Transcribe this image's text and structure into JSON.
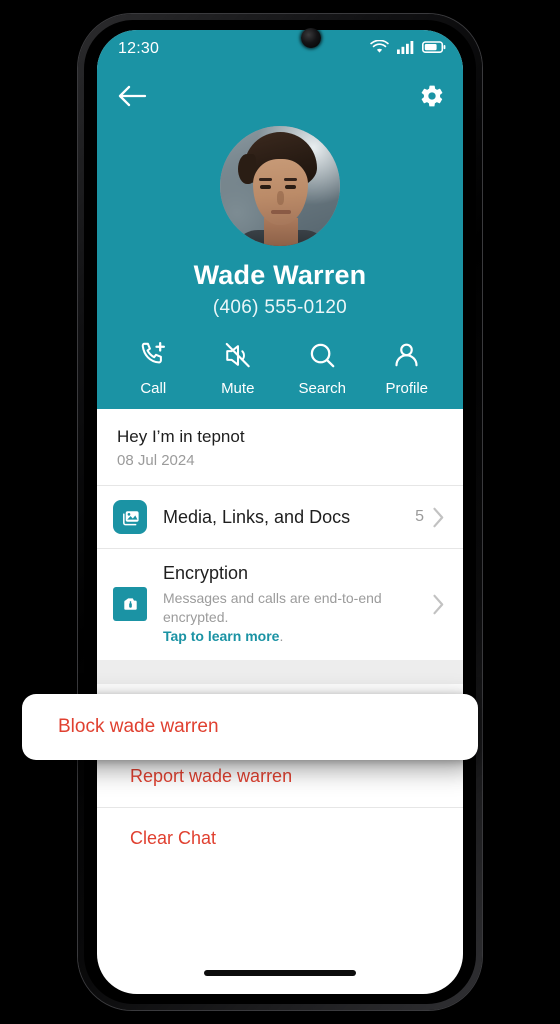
{
  "status_bar": {
    "time": "12:30",
    "icons": [
      "wifi-icon",
      "cellular-signal-icon",
      "battery-icon"
    ]
  },
  "header": {
    "back_icon": "back-arrow-icon",
    "settings_icon": "gear-icon",
    "contact_name": "Wade Warren",
    "contact_phone": "(406) 555-0120",
    "accent_color": "#1b93a4",
    "actions": [
      {
        "label": "Call",
        "icon": "phone-add-icon"
      },
      {
        "label": "Mute",
        "icon": "speaker-mute-icon"
      },
      {
        "label": "Search",
        "icon": "search-icon"
      },
      {
        "label": "Profile",
        "icon": "person-icon"
      }
    ]
  },
  "status_message": {
    "text": "Hey I’m in tepnot",
    "date": "08 Jul 2024"
  },
  "media_row": {
    "icon": "media-gallery-icon",
    "title": "Media, Links, and Docs",
    "count": "5",
    "chevron": "chevron-right-icon"
  },
  "encryption_row": {
    "icon": "encryption-lock-icon",
    "title": "Encryption",
    "description": "Messages and calls are end-to-end encrypted.",
    "link_text": "Tap to learn more",
    "link_suffix": ".",
    "link_color": "#1b93a4",
    "chevron": "chevron-right-icon"
  },
  "danger_actions": {
    "color": "#e04030",
    "block_label": "Block wade warren",
    "report_label": "Report wade warren",
    "clear_label": "Clear Chat"
  },
  "system": {
    "home_indicator": "home-indicator-bar"
  }
}
